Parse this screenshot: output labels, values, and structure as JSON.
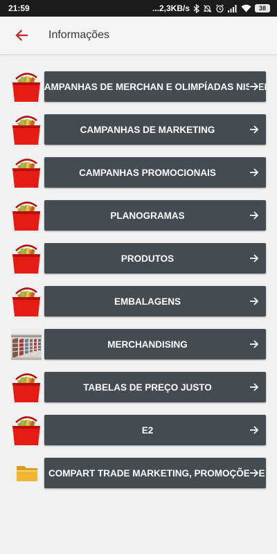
{
  "status_bar": {
    "time": "21:59",
    "network_speed": "...2,3KB/s",
    "battery": "38",
    "icons": [
      "bluetooth-icon",
      "mute-icon",
      "alarm-icon",
      "signal-icon",
      "wifi-icon",
      "battery-icon"
    ]
  },
  "app_bar": {
    "title": "Informações",
    "back_icon": "arrow-left-icon",
    "accent_color": "#c62828"
  },
  "items": [
    {
      "label": "CAMPANHAS DE MERCHAN E OLIMPÍADAS NISSEI",
      "icon": "basket-icon",
      "truncated": true
    },
    {
      "label": "CAMPANHAS DE MARKETING",
      "icon": "basket-icon"
    },
    {
      "label": "CAMPANHAS PROMOCIONAIS",
      "icon": "basket-icon"
    },
    {
      "label": "PLANOGRAMAS",
      "icon": "basket-icon"
    },
    {
      "label": "PRODUTOS",
      "icon": "basket-icon"
    },
    {
      "label": "EMBALAGENS",
      "icon": "basket-icon"
    },
    {
      "label": "MERCHANDISING",
      "icon": "store-shelves-photo"
    },
    {
      "label": "TABELAS DE PREÇO JUSTO",
      "icon": "basket-icon"
    },
    {
      "label": "E2",
      "icon": "basket-icon"
    },
    {
      "label": "COMPART TRADE MARKETING, PROMOÇÕES E",
      "icon": "folder-icon",
      "truncated": true
    }
  ],
  "colors": {
    "button_bg": "#454b51",
    "background": "#f1f1f1",
    "basket_red": "#e51b14",
    "folder_yellow": "#f4b533"
  }
}
